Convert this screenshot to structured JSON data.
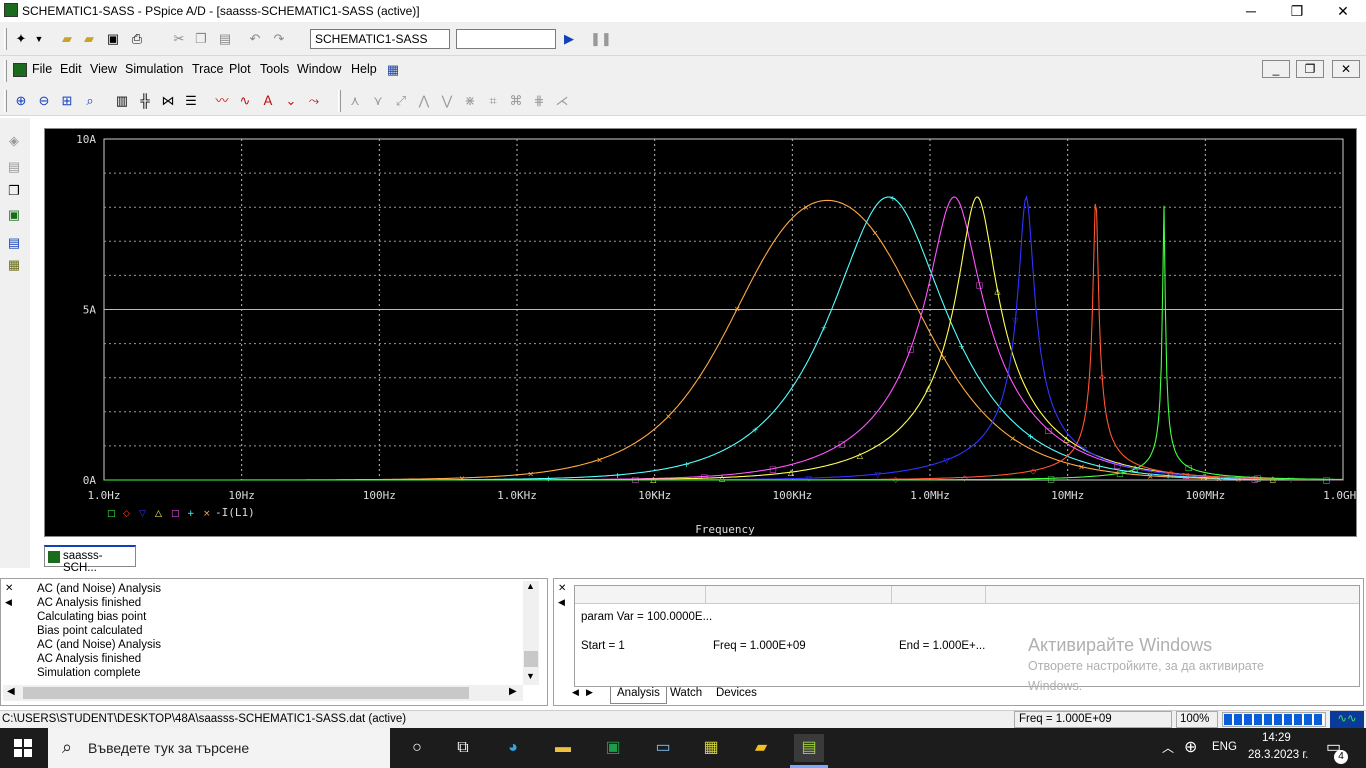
{
  "window": {
    "title": "SCHEMATIC1-SASS - PSpice A/D  - [saasss-SCHEMATIC1-SASS (active)]",
    "minimize": "─",
    "restore": "❐",
    "close": "✕"
  },
  "toolbar1": {
    "profile_select": "SCHEMATIC1-SASS",
    "sim_field": "",
    "run_icon": "play-icon",
    "pause_icon": "pause-icon"
  },
  "menu": {
    "items": [
      "File",
      "Edit",
      "View",
      "Simulation",
      "Trace",
      "Plot",
      "Tools",
      "Window",
      "Help"
    ]
  },
  "plot": {
    "legend_text": "-I(L1)",
    "legend_markers": [
      "□",
      "◇",
      "▽",
      "△",
      "□",
      "+",
      "×"
    ],
    "legend_colors": [
      "#44ff44",
      "#ff5533",
      "#3333ff",
      "#ffff55",
      "#ff55ff",
      "#55ffff",
      "#ffaa44"
    ]
  },
  "chart_data": {
    "type": "line",
    "title": "",
    "xlabel": "Frequency",
    "ylabel": "",
    "x_scale": "log",
    "x_ticks": [
      "1.0Hz",
      "10Hz",
      "100Hz",
      "1.0KHz",
      "10KHz",
      "100KHz",
      "1.0MHz",
      "10MHz",
      "100MHz",
      "1.0GHz"
    ],
    "y_ticks": [
      "0A",
      "5A",
      "10A"
    ],
    "xlim": [
      "1.0Hz",
      "1.0GHz"
    ],
    "ylim": [
      0,
      10
    ],
    "grid": true,
    "series": [
      {
        "color": "#ffaa44",
        "marker": "×",
        "peak_hz": 180000,
        "peak_a": 8.2,
        "q": 0.3
      },
      {
        "color": "#55ffff",
        "marker": "+",
        "peak_hz": 500000,
        "peak_a": 8.3,
        "q": 0.6
      },
      {
        "color": "#ff55ff",
        "marker": "□",
        "peak_hz": 1500000,
        "peak_a": 8.3,
        "q": 1.2
      },
      {
        "color": "#ffff55",
        "marker": "△",
        "peak_hz": 2200000,
        "peak_a": 8.3,
        "q": 1.6
      },
      {
        "color": "#3333ff",
        "marker": "▽",
        "peak_hz": 5000000,
        "peak_a": 8.3,
        "q": 4
      },
      {
        "color": "#ff5533",
        "marker": "◇",
        "peak_hz": 16000000,
        "peak_a": 8.3,
        "q": 12
      },
      {
        "color": "#44ff44",
        "marker": "□",
        "peak_hz": 50000000,
        "peak_a": 8.1,
        "q": 25
      }
    ]
  },
  "doc_tab": {
    "label": "saasss-SCH..."
  },
  "output_log": {
    "lines": [
      "AC (and Noise) Analysis",
      "AC Analysis finished",
      "Calculating bias point",
      "Bias point calculated",
      "AC (and Noise) Analysis",
      "AC Analysis finished",
      "Simulation complete"
    ]
  },
  "sim_status": {
    "param": "param Var =  100.0000E...",
    "start": "Start =  1",
    "freq": "Freq =  1.000E+09",
    "end": "End =  1.000E+...",
    "tabs": [
      "Analysis",
      "Watch",
      "Devices"
    ]
  },
  "watermark": {
    "line1": "Активирайте Windows",
    "line2": "Отворете настройките, за да активирате",
    "line3": "Windows."
  },
  "statusbar": {
    "path": "C:\\USERS\\STUDENT\\DESKTOP\\48A\\saasss-SCHEMATIC1-SASS.dat (active)",
    "freq": "Freq =  1.000E+09",
    "zoom": "100%"
  },
  "taskbar": {
    "search_placeholder": "Въведете тук за търсене",
    "lang": "ENG",
    "time": "14:29",
    "date": "28.3.2023 г.",
    "notifications": "4"
  }
}
